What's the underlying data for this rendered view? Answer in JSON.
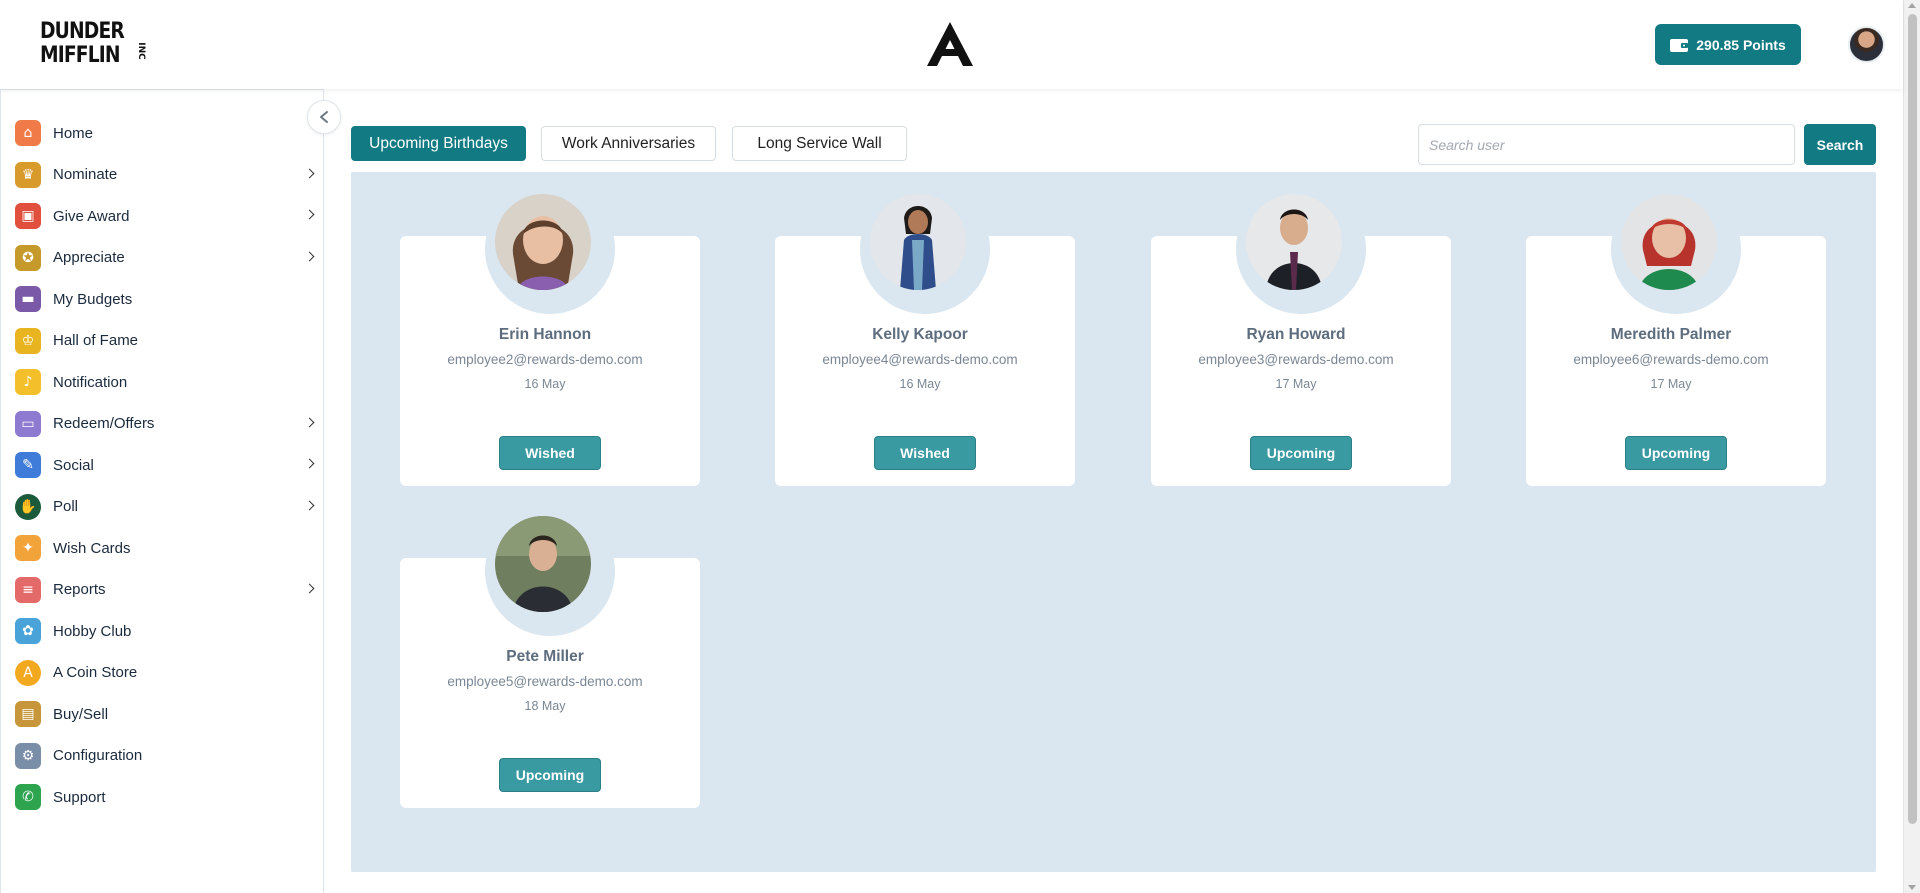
{
  "header": {
    "logo_line1": "DUNDER",
    "logo_line2": "MIFFLIN",
    "logo_inc": "INC",
    "points_label": "290.85  Points",
    "colors": {
      "accent": "#127a82",
      "panel": "#dae6f0",
      "button": "#3a9aa2"
    }
  },
  "sidebar": {
    "items": [
      {
        "label": "Home",
        "icon": "home-icon",
        "has_submenu": false
      },
      {
        "label": "Nominate",
        "icon": "trophy-icon",
        "has_submenu": true
      },
      {
        "label": "Give Award",
        "icon": "gift-icon",
        "has_submenu": true
      },
      {
        "label": "Appreciate",
        "icon": "medal-icon",
        "has_submenu": true
      },
      {
        "label": "My Budgets",
        "icon": "wallet-icon",
        "has_submenu": false
      },
      {
        "label": "Hall of Fame",
        "icon": "crown-icon",
        "has_submenu": false
      },
      {
        "label": "Notification",
        "icon": "bell-icon",
        "has_submenu": false
      },
      {
        "label": "Redeem/Offers",
        "icon": "card-icon",
        "has_submenu": true
      },
      {
        "label": "Social",
        "icon": "chat-icon",
        "has_submenu": true
      },
      {
        "label": "Poll",
        "icon": "poll-icon",
        "has_submenu": true
      },
      {
        "label": "Wish Cards",
        "icon": "party-popper-icon",
        "has_submenu": false
      },
      {
        "label": "Reports",
        "icon": "clipboard-icon",
        "has_submenu": true
      },
      {
        "label": "Hobby Club",
        "icon": "hobby-icon",
        "has_submenu": false
      },
      {
        "label": "A Coin Store",
        "icon": "coin-icon",
        "has_submenu": false
      },
      {
        "label": "Buy/Sell",
        "icon": "shopping-bag-icon",
        "has_submenu": false
      },
      {
        "label": "Configuration",
        "icon": "config-icon",
        "has_submenu": false
      },
      {
        "label": "Support",
        "icon": "phone-icon",
        "has_submenu": false
      }
    ]
  },
  "tabs": [
    {
      "label": "Upcoming Birthdays",
      "active": true
    },
    {
      "label": "Work Anniversaries",
      "active": false
    },
    {
      "label": "Long Service Wall",
      "active": false
    }
  ],
  "search": {
    "placeholder": "Search user",
    "value": "",
    "button_label": "Search"
  },
  "cards": [
    {
      "name": "Erin Hannon",
      "email": "employee2@rewards-demo.com",
      "date": "16 May",
      "status": "Wished"
    },
    {
      "name": "Kelly Kapoor",
      "email": "employee4@rewards-demo.com",
      "date": "16 May",
      "status": "Wished"
    },
    {
      "name": "Ryan Howard",
      "email": "employee3@rewards-demo.com",
      "date": "17 May",
      "status": "Upcoming"
    },
    {
      "name": "Meredith Palmer",
      "email": "employee6@rewards-demo.com",
      "date": "17 May",
      "status": "Upcoming"
    },
    {
      "name": "Pete Miller",
      "email": "employee5@rewards-demo.com",
      "date": "18 May",
      "status": "Upcoming"
    }
  ]
}
